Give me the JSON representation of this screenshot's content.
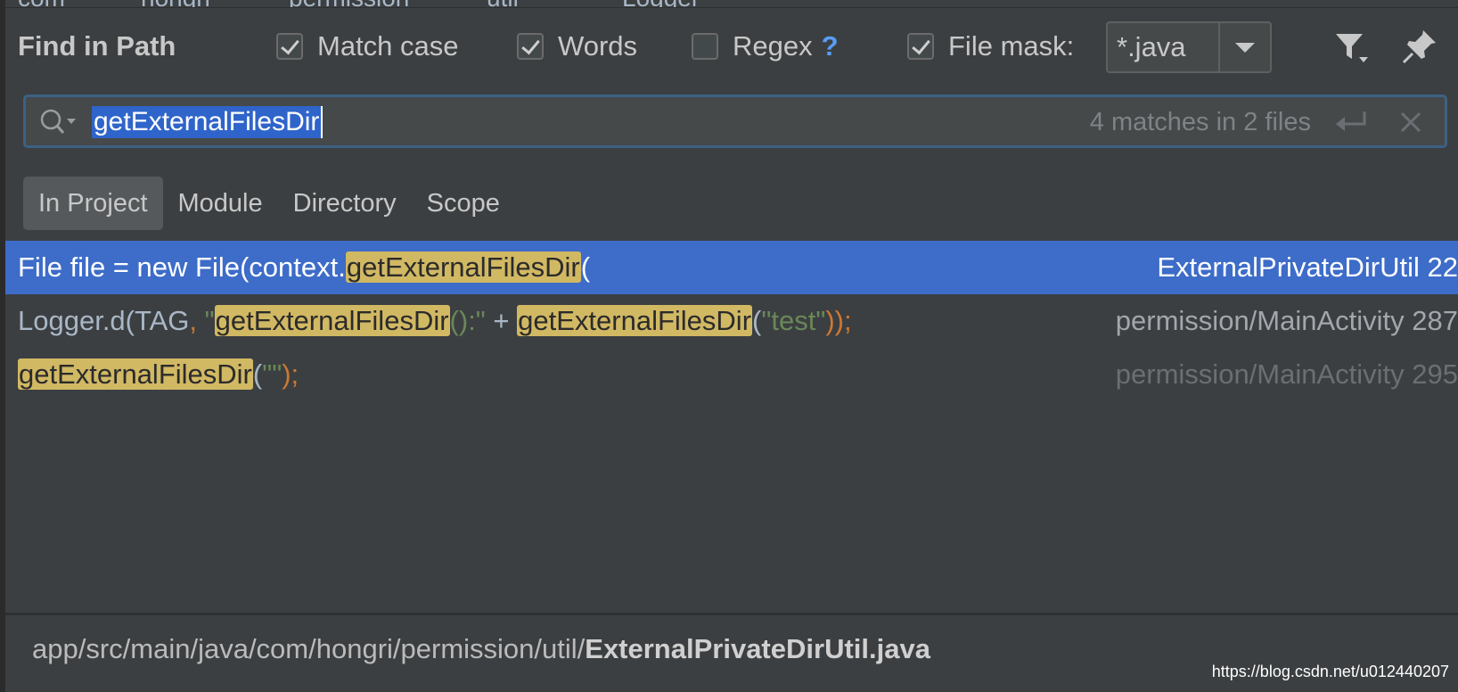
{
  "breadcrumb": [
    "com",
    "hongri",
    "permission",
    "util",
    "Logger"
  ],
  "dialog": {
    "title": "Find in Path"
  },
  "options": {
    "match_case": {
      "label": "Match case",
      "checked": true
    },
    "words": {
      "label": "Words",
      "checked": true
    },
    "regex": {
      "label": "Regex",
      "checked": false,
      "help": "?"
    },
    "file_mask": {
      "label": "File mask:",
      "checked": true,
      "value": "*.java"
    }
  },
  "search": {
    "query": "getExternalFilesDir",
    "matches": "4 matches in 2 files"
  },
  "scope_tabs": [
    {
      "label": "In Project",
      "active": true
    },
    {
      "label": "Module",
      "active": false
    },
    {
      "label": "Directory",
      "active": false
    },
    {
      "label": "Scope",
      "active": false
    }
  ],
  "results": [
    {
      "parts": [
        "File file = new File(context.",
        "getExternalFilesDir",
        "("
      ],
      "file": "ExternalPrivateDirUtil 22"
    },
    {
      "parts": [
        "Logger.d(TAG",
        ", ",
        "\"",
        "getExternalFilesDir",
        "():\"",
        " + ",
        "getExternalFilesDir",
        "(",
        "\"test\"",
        "));"
      ],
      "file": "permission/MainActivity 287"
    },
    {
      "parts": [
        "getExternalFilesDir",
        "(",
        "\"\"",
        ");"
      ],
      "file": "permission/MainActivity 295"
    }
  ],
  "footer": {
    "path_prefix": "app/src/main/java/com/hongri/permission/util/",
    "path_file": "ExternalPrivateDirUtil.java"
  },
  "watermark": "https://blog.csdn.net/u012440207",
  "colors": {
    "selection": "#3d6cc9",
    "highlight": "#d1b863",
    "background": "#3c3f41",
    "accent": "#589df6"
  }
}
